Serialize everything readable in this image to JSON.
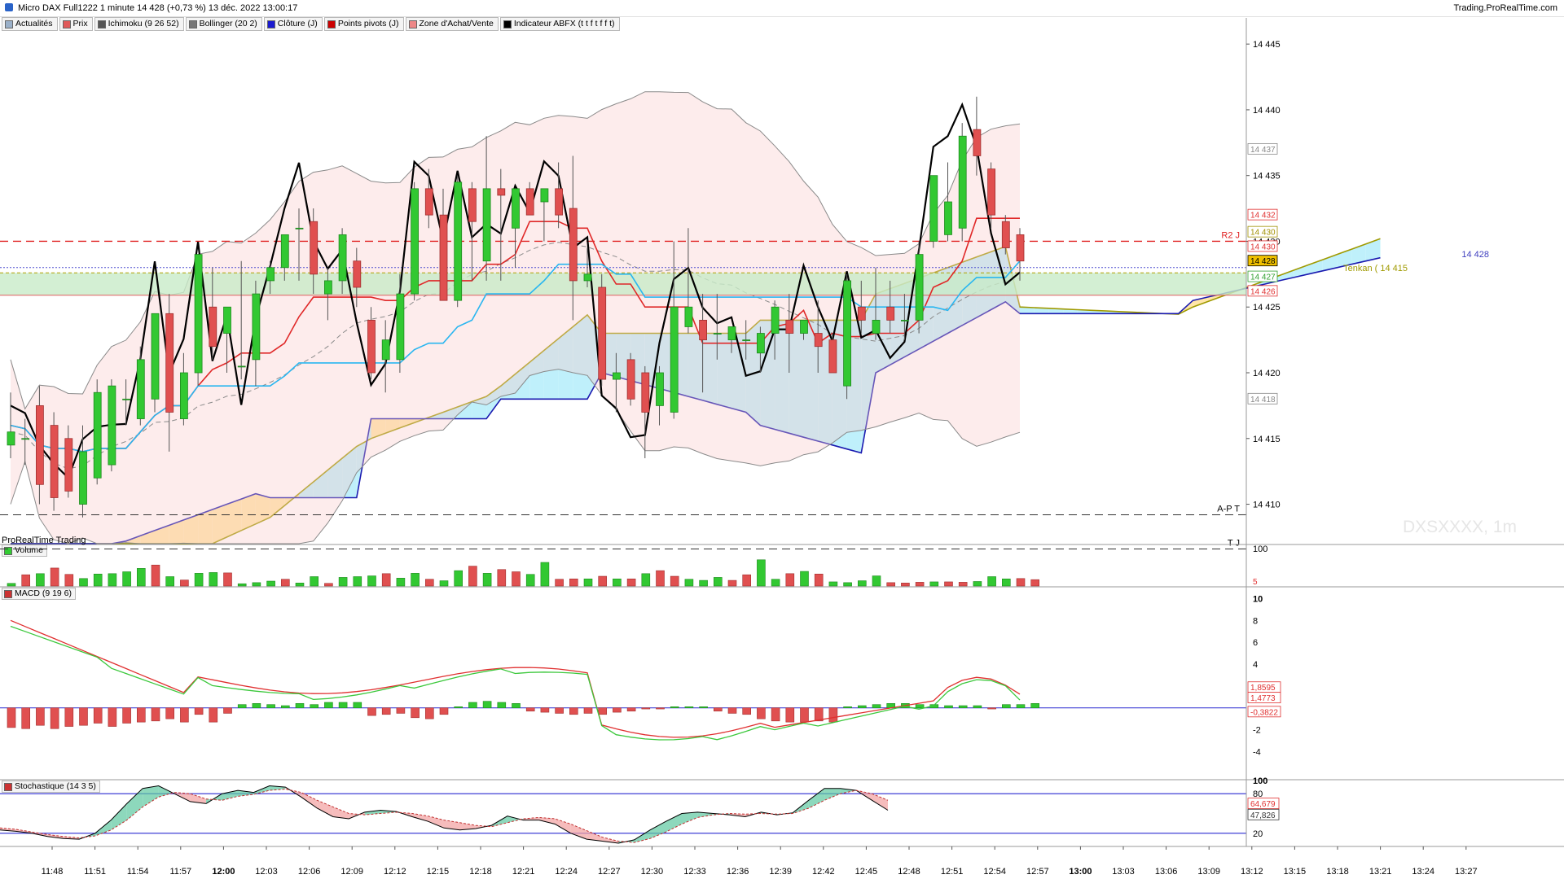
{
  "header": {
    "title": "Micro DAX Full1222 1 minute 14 428 (+0,73 %) 13 déc. 2022 13:00:17",
    "brand": "Trading.ProRealTime.com"
  },
  "legend": [
    {
      "label": "Actualités",
      "color": "#9ab0c9"
    },
    {
      "label": "Prix",
      "color": "#e05a5a"
    },
    {
      "label": "Ichimoku (9 26 52)",
      "color": "#555555"
    },
    {
      "label": "Bollinger (20 2)",
      "color": "#777777"
    },
    {
      "label": "Clôture (J)",
      "color": "#1a1ad0"
    },
    {
      "label": "Points pivots (J)",
      "color": "#cc0000"
    },
    {
      "label": "Zone d'Achat/Vente",
      "color": "#e88"
    },
    {
      "label": "Indicateur ABFX (t t f t f f t)",
      "color": "#000000"
    }
  ],
  "panels": {
    "volume_label": "Volume",
    "macd_label": "MACD (9 19 6)",
    "stoch_label": "Stochastique (14 3 5)",
    "prt_label": "ProRealTime Trading",
    "watermark": "DXSXXXX, 1m"
  },
  "price_annotations": {
    "r2": "R2 J",
    "apt": "A-P T",
    "tj": "T J",
    "tenkan": "Tenkan ( 14 415",
    "last_left": "14 428",
    "tags": [
      {
        "text": "14 437",
        "price": 14437,
        "color": "#888888",
        "bg": "#ffffff"
      },
      {
        "text": "14 432",
        "price": 14432,
        "color": "#e03030",
        "bg": "#ffffff"
      },
      {
        "text": "14 430",
        "price": 14430.7,
        "color": "#a09000",
        "bg": "#ffffff"
      },
      {
        "text": "14 430",
        "price": 14429.6,
        "color": "#e03030",
        "bg": "#ffffff"
      },
      {
        "text": "14 428",
        "price": 14428.5,
        "color": "#000000",
        "bg": "#f0c000"
      },
      {
        "text": "14 427",
        "price": 14427.3,
        "color": "#30a030",
        "bg": "#ffffff"
      },
      {
        "text": "14 426",
        "price": 14426.2,
        "color": "#e03030",
        "bg": "#ffffff"
      },
      {
        "text": "14 418",
        "price": 14418,
        "color": "#888888",
        "bg": "#ffffff"
      }
    ]
  },
  "macd_tags": [
    {
      "text": "1,8595",
      "v": 1.86,
      "color": "#e03030"
    },
    {
      "text": "1,4773",
      "v": 0.9,
      "color": "#e03030"
    },
    {
      "text": "-0,3822",
      "v": -0.38,
      "color": "#e03030"
    }
  ],
  "stoch_tags": [
    {
      "text": "64,679",
      "v": 64.7,
      "color": "#e03030"
    },
    {
      "text": "47,826",
      "v": 47.8,
      "color": "#333333"
    }
  ],
  "chart_data": {
    "type": "candlestick",
    "time_labels": [
      "11:48",
      "11:51",
      "11:54",
      "11:57",
      "12:00",
      "12:03",
      "12:06",
      "12:09",
      "12:12",
      "12:15",
      "12:18",
      "12:21",
      "12:24",
      "12:27",
      "12:30",
      "12:33",
      "12:36",
      "12:39",
      "12:42",
      "12:45",
      "12:48",
      "12:51",
      "12:54",
      "12:57",
      "13:00",
      "13:03",
      "13:06",
      "13:09",
      "13:12",
      "13:15",
      "13:18",
      "13:21",
      "13:24",
      "13:27"
    ],
    "price_axis": {
      "ticks": [
        14410,
        14415,
        14420,
        14425,
        14430,
        14435,
        14440,
        14445
      ],
      "labels": [
        "14 410",
        "14 415",
        "14 420",
        "14 425",
        "14 430",
        "14 435",
        "14 440",
        "14 445"
      ],
      "range": [
        14407,
        14446
      ]
    },
    "volume_axis": {
      "ticks": [
        100
      ],
      "labels": [
        "100"
      ],
      "last_value": "5"
    },
    "macd_axis": {
      "ticks": [
        10,
        8,
        6,
        4,
        2,
        -2,
        -4
      ],
      "labels": [
        "10",
        "8",
        "6",
        "4",
        "2",
        "-2",
        "-4"
      ],
      "range": [
        -6.5,
        11
      ]
    },
    "stoch_axis": {
      "ticks": [
        100,
        80,
        20
      ],
      "labels": [
        "100",
        "80",
        "20"
      ],
      "range": [
        0,
        100
      ]
    },
    "levels": {
      "r2_j": 14430,
      "a_p_t": 14409.2,
      "t_j": 14406.6,
      "last_price": 14428,
      "tenkan_level": 14427.6
    },
    "candles": [
      {
        "o": 14414.5,
        "h": 14418.5,
        "l": 14413.5,
        "c": 14415.5
      },
      {
        "o": 14415.0,
        "h": 14416.5,
        "l": 14413.0,
        "c": 14415.0
      },
      {
        "o": 14417.5,
        "h": 14419.0,
        "l": 14410.0,
        "c": 14411.5
      },
      {
        "o": 14416.0,
        "h": 14417.0,
        "l": 14409.5,
        "c": 14410.5
      },
      {
        "o": 14415.0,
        "h": 14416.0,
        "l": 14410.5,
        "c": 14411.0
      },
      {
        "o": 14410.0,
        "h": 14416.0,
        "l": 14409.0,
        "c": 14414.0
      },
      {
        "o": 14412.0,
        "h": 14419.5,
        "l": 14411.5,
        "c": 14418.5
      },
      {
        "o": 14413.0,
        "h": 14419.5,
        "l": 14412.5,
        "c": 14419.0
      },
      {
        "o": 14418.0,
        "h": 14419.5,
        "l": 14416.0,
        "c": 14418.0
      },
      {
        "o": 14416.5,
        "h": 14422.0,
        "l": 14416.0,
        "c": 14421.0
      },
      {
        "o": 14418.0,
        "h": 14424.5,
        "l": 14417.0,
        "c": 14424.5
      },
      {
        "o": 14424.5,
        "h": 14426.0,
        "l": 14414.0,
        "c": 14417.0
      },
      {
        "o": 14416.5,
        "h": 14421.5,
        "l": 14416.0,
        "c": 14420.0
      },
      {
        "o": 14420.0,
        "h": 14429.0,
        "l": 14419.0,
        "c": 14429.0
      },
      {
        "o": 14425.0,
        "h": 14428.0,
        "l": 14421.0,
        "c": 14422.0
      },
      {
        "o": 14423.0,
        "h": 14425.0,
        "l": 14420.0,
        "c": 14425.0
      },
      {
        "o": 14420.5,
        "h": 14428.5,
        "l": 14419.5,
        "c": 14420.5
      },
      {
        "o": 14421.0,
        "h": 14427.0,
        "l": 14419.0,
        "c": 14426.0
      },
      {
        "o": 14427.0,
        "h": 14428.5,
        "l": 14426.0,
        "c": 14428.0
      },
      {
        "o": 14428.0,
        "h": 14430.5,
        "l": 14427.0,
        "c": 14430.5
      },
      {
        "o": 14431.0,
        "h": 14432.5,
        "l": 14427.0,
        "c": 14431.0
      },
      {
        "o": 14431.5,
        "h": 14432.5,
        "l": 14426.0,
        "c": 14427.5
      },
      {
        "o": 14426.0,
        "h": 14428.0,
        "l": 14424.0,
        "c": 14427.0
      },
      {
        "o": 14427.0,
        "h": 14431.0,
        "l": 14426.0,
        "c": 14430.5
      },
      {
        "o": 14428.5,
        "h": 14429.5,
        "l": 14425.0,
        "c": 14426.5
      },
      {
        "o": 14424.0,
        "h": 14425.0,
        "l": 14419.5,
        "c": 14420.0
      },
      {
        "o": 14421.0,
        "h": 14424.0,
        "l": 14418.5,
        "c": 14422.5
      },
      {
        "o": 14421.0,
        "h": 14427.5,
        "l": 14420.0,
        "c": 14426.0
      },
      {
        "o": 14426.0,
        "h": 14434.5,
        "l": 14425.5,
        "c": 14434.0
      },
      {
        "o": 14434.0,
        "h": 14435.5,
        "l": 14431.0,
        "c": 14432.0
      },
      {
        "o": 14432.0,
        "h": 14434.0,
        "l": 14425.5,
        "c": 14425.5
      },
      {
        "o": 14425.5,
        "h": 14435.0,
        "l": 14425.0,
        "c": 14434.5
      },
      {
        "o": 14434.0,
        "h": 14434.5,
        "l": 14427.0,
        "c": 14431.5
      },
      {
        "o": 14428.5,
        "h": 14438.0,
        "l": 14427.0,
        "c": 14434.0
      },
      {
        "o": 14434.0,
        "h": 14435.5,
        "l": 14427.0,
        "c": 14433.5
      },
      {
        "o": 14431.0,
        "h": 14434.0,
        "l": 14428.0,
        "c": 14434.0
      },
      {
        "o": 14434.0,
        "h": 14434.5,
        "l": 14432.0,
        "c": 14432.0
      },
      {
        "o": 14433.0,
        "h": 14434.0,
        "l": 14430.0,
        "c": 14434.0
      },
      {
        "o": 14434.0,
        "h": 14436.0,
        "l": 14431.0,
        "c": 14432.0
      },
      {
        "o": 14432.5,
        "h": 14436.5,
        "l": 14424.0,
        "c": 14427.0
      },
      {
        "o": 14427.0,
        "h": 14429.5,
        "l": 14426.5,
        "c": 14427.5
      },
      {
        "o": 14426.5,
        "h": 14427.5,
        "l": 14419.0,
        "c": 14419.5
      },
      {
        "o": 14419.5,
        "h": 14421.5,
        "l": 14417.0,
        "c": 14420.0
      },
      {
        "o": 14421.0,
        "h": 14421.5,
        "l": 14417.5,
        "c": 14418.0
      },
      {
        "o": 14420.0,
        "h": 14420.5,
        "l": 14413.5,
        "c": 14417.0
      },
      {
        "o": 14417.5,
        "h": 14420.5,
        "l": 14416.0,
        "c": 14420.0
      },
      {
        "o": 14417.0,
        "h": 14430.0,
        "l": 14416.5,
        "c": 14425.0
      },
      {
        "o": 14423.5,
        "h": 14431.0,
        "l": 14423.0,
        "c": 14425.0
      },
      {
        "o": 14424.0,
        "h": 14426.0,
        "l": 14418.5,
        "c": 14422.5
      },
      {
        "o": 14423.0,
        "h": 14426.0,
        "l": 14421.0,
        "c": 14423.0
      },
      {
        "o": 14422.5,
        "h": 14423.5,
        "l": 14421.5,
        "c": 14423.5
      },
      {
        "o": 14422.5,
        "h": 14424.0,
        "l": 14421.0,
        "c": 14422.5
      },
      {
        "o": 14421.5,
        "h": 14423.5,
        "l": 14420.0,
        "c": 14423.0
      },
      {
        "o": 14423.0,
        "h": 14425.5,
        "l": 14421.0,
        "c": 14425.0
      },
      {
        "o": 14424.0,
        "h": 14426.0,
        "l": 14420.0,
        "c": 14423.0
      },
      {
        "o": 14423.0,
        "h": 14424.0,
        "l": 14422.5,
        "c": 14424.0
      },
      {
        "o": 14423.0,
        "h": 14425.5,
        "l": 14420.0,
        "c": 14422.0
      },
      {
        "o": 14422.5,
        "h": 14423.0,
        "l": 14420.0,
        "c": 14420.0
      },
      {
        "o": 14419.0,
        "h": 14427.5,
        "l": 14418.0,
        "c": 14427.0
      },
      {
        "o": 14425.0,
        "h": 14427.0,
        "l": 14423.0,
        "c": 14424.0
      },
      {
        "o": 14423.0,
        "h": 14428.0,
        "l": 14422.5,
        "c": 14424.0
      },
      {
        "o": 14425.0,
        "h": 14427.0,
        "l": 14423.0,
        "c": 14424.0
      },
      {
        "o": 14424.0,
        "h": 14426.0,
        "l": 14422.5,
        "c": 14424.0
      },
      {
        "o": 14424.0,
        "h": 14430.0,
        "l": 14423.0,
        "c": 14429.0
      },
      {
        "o": 14430.0,
        "h": 14435.0,
        "l": 14429.5,
        "c": 14435.0
      },
      {
        "o": 14430.5,
        "h": 14436.0,
        "l": 14430.0,
        "c": 14433.0
      },
      {
        "o": 14431.0,
        "h": 14439.0,
        "l": 14430.0,
        "c": 14438.0
      },
      {
        "o": 14438.5,
        "h": 14441.0,
        "l": 14435.0,
        "c": 14436.5
      },
      {
        "o": 14435.5,
        "h": 14436.0,
        "l": 14431.0,
        "c": 14432.0
      },
      {
        "o": 14431.5,
        "h": 14432.0,
        "l": 14429.0,
        "c": 14429.5
      },
      {
        "o": 14430.5,
        "h": 14431.0,
        "l": 14427.0,
        "c": 14428.5
      }
    ],
    "volume": [
      {
        "v": 7,
        "up": true
      },
      {
        "v": 30,
        "up": false
      },
      {
        "v": 33,
        "up": true
      },
      {
        "v": 48,
        "up": false
      },
      {
        "v": 31,
        "up": false
      },
      {
        "v": 20,
        "up": true
      },
      {
        "v": 32,
        "up": true
      },
      {
        "v": 33,
        "up": true
      },
      {
        "v": 38,
        "up": true
      },
      {
        "v": 47,
        "up": true
      },
      {
        "v": 56,
        "up": false
      },
      {
        "v": 25,
        "up": true
      },
      {
        "v": 16,
        "up": false
      },
      {
        "v": 34,
        "up": true
      },
      {
        "v": 36,
        "up": true
      },
      {
        "v": 35,
        "up": false
      },
      {
        "v": 6,
        "up": true
      },
      {
        "v": 9,
        "up": true
      },
      {
        "v": 13,
        "up": true
      },
      {
        "v": 18,
        "up": false
      },
      {
        "v": 8,
        "up": true
      },
      {
        "v": 25,
        "up": true
      },
      {
        "v": 7,
        "up": false
      },
      {
        "v": 23,
        "up": true
      },
      {
        "v": 25,
        "up": true
      },
      {
        "v": 27,
        "up": true
      },
      {
        "v": 33,
        "up": false
      },
      {
        "v": 21,
        "up": true
      },
      {
        "v": 34,
        "up": true
      },
      {
        "v": 18,
        "up": false
      },
      {
        "v": 14,
        "up": true
      },
      {
        "v": 41,
        "up": true
      },
      {
        "v": 53,
        "up": false
      },
      {
        "v": 34,
        "up": true
      },
      {
        "v": 44,
        "up": false
      },
      {
        "v": 38,
        "up": false
      },
      {
        "v": 31,
        "up": true
      },
      {
        "v": 63,
        "up": true
      },
      {
        "v": 18,
        "up": false
      },
      {
        "v": 19,
        "up": false
      },
      {
        "v": 19,
        "up": true
      },
      {
        "v": 26,
        "up": false
      },
      {
        "v": 19,
        "up": true
      },
      {
        "v": 19,
        "up": false
      },
      {
        "v": 33,
        "up": true
      },
      {
        "v": 41,
        "up": false
      },
      {
        "v": 26,
        "up": false
      },
      {
        "v": 18,
        "up": true
      },
      {
        "v": 15,
        "up": true
      },
      {
        "v": 23,
        "up": true
      },
      {
        "v": 15,
        "up": false
      },
      {
        "v": 30,
        "up": false
      },
      {
        "v": 70,
        "up": true
      },
      {
        "v": 18,
        "up": true
      },
      {
        "v": 33,
        "up": false
      },
      {
        "v": 39,
        "up": true
      },
      {
        "v": 32,
        "up": false
      },
      {
        "v": 11,
        "up": true
      },
      {
        "v": 9,
        "up": true
      },
      {
        "v": 14,
        "up": true
      },
      {
        "v": 27,
        "up": true
      },
      {
        "v": 9,
        "up": false
      },
      {
        "v": 8,
        "up": false
      },
      {
        "v": 10,
        "up": false
      },
      {
        "v": 11,
        "up": true
      },
      {
        "v": 11,
        "up": false
      },
      {
        "v": 10,
        "up": false
      },
      {
        "v": 12,
        "up": true
      },
      {
        "v": 25,
        "up": true
      },
      {
        "v": 19,
        "up": true
      },
      {
        "v": 20,
        "up": false
      },
      {
        "v": 17,
        "up": false
      }
    ],
    "macd_hist": [
      -1.8,
      -1.9,
      -1.6,
      -1.9,
      -1.7,
      -1.6,
      -1.4,
      -1.7,
      -1.4,
      -1.3,
      -1.2,
      -1.0,
      -1.3,
      -0.6,
      -1.3,
      -0.5,
      0.3,
      0.4,
      0.3,
      0.2,
      0.4,
      0.3,
      0.5,
      0.5,
      0.5,
      -0.7,
      -0.6,
      -0.5,
      -0.9,
      -1.0,
      -0.6,
      0.1,
      0.5,
      0.6,
      0.5,
      0.4,
      -0.3,
      -0.4,
      -0.5,
      -0.6,
      -0.5,
      -0.6,
      -0.4,
      -0.3,
      -0.1,
      -0.1,
      0.1,
      0.1,
      0.1,
      -0.3,
      -0.5,
      -0.6,
      -1.0,
      -1.2,
      -1.3,
      -1.3,
      -1.2,
      -1.3,
      0.1,
      0.2,
      0.3,
      0.4,
      0.4,
      0.3,
      0.3,
      0.2,
      0.2,
      0.2,
      -0.1,
      0.3,
      0.3,
      0.4
    ],
    "stoch_k": [
      25,
      23,
      20,
      15,
      12,
      11,
      20,
      40,
      65,
      88,
      92,
      80,
      68,
      65,
      80,
      85,
      82,
      92,
      90,
      75,
      58,
      45,
      42,
      52,
      55,
      53,
      45,
      38,
      28,
      25,
      27,
      32,
      46,
      40,
      40,
      34,
      20,
      11,
      8,
      5,
      10,
      25,
      38,
      50,
      52,
      50,
      48,
      45,
      52,
      48,
      51,
      70,
      88,
      88,
      85,
      70,
      55
    ],
    "stoch_d": [
      28,
      26,
      22,
      18,
      15,
      13,
      16,
      25,
      40,
      60,
      75,
      82,
      80,
      72,
      70,
      76,
      79,
      85,
      87,
      82,
      70,
      60,
      50,
      48,
      50,
      52,
      50,
      46,
      40,
      36,
      32,
      30,
      36,
      42,
      44,
      42,
      34,
      24,
      14,
      8,
      6,
      12,
      22,
      34,
      44,
      48,
      50,
      49,
      50,
      49,
      50,
      58,
      70,
      80,
      85,
      80,
      70
    ]
  }
}
